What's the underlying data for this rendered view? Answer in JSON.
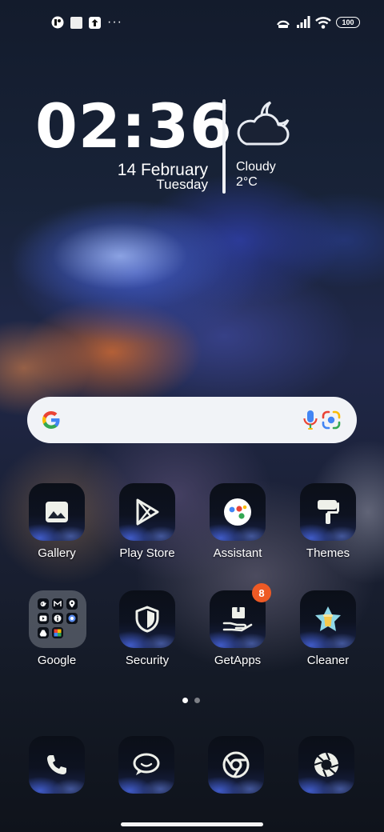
{
  "status_bar": {
    "notification_icons": [
      "notification-app-icon",
      "notification-square-icon",
      "notification-upload-icon"
    ],
    "more": "···",
    "system_icons": [
      "hotspot-icon",
      "signal-icon",
      "wifi-icon"
    ],
    "battery": "100"
  },
  "clock": {
    "time": "02:36",
    "date": "14  February",
    "day": "Tuesday"
  },
  "weather": {
    "condition": "Cloudy",
    "temperature": "2°C",
    "icon": "cloud-moon-icon"
  },
  "search": {
    "icons": [
      "google-g-icon",
      "microphone-icon",
      "google-lens-icon"
    ]
  },
  "apps": [
    {
      "label": "Gallery",
      "icon": "gallery-icon"
    },
    {
      "label": "Play Store",
      "icon": "play-store-icon"
    },
    {
      "label": "Assistant",
      "icon": "assistant-icon"
    },
    {
      "label": "Themes",
      "icon": "themes-icon"
    },
    {
      "label": "Google",
      "icon": "folder-icon"
    },
    {
      "label": "Security",
      "icon": "shield-icon"
    },
    {
      "label": "GetApps",
      "icon": "getapps-icon",
      "badge": "8"
    },
    {
      "label": "Cleaner",
      "icon": "cleaner-icon"
    }
  ],
  "folder_contents": [
    "google-g-icon",
    "gmail-icon",
    "maps-icon",
    "youtube-icon",
    "info-icon",
    "chrome-icon",
    "drive-icon",
    "photos-icon"
  ],
  "page_indicator": {
    "pages": 2,
    "current": 1
  },
  "dock": [
    {
      "icon": "phone-icon"
    },
    {
      "icon": "messages-icon"
    },
    {
      "icon": "chrome-icon"
    },
    {
      "icon": "camera-icon"
    }
  ],
  "colors": {
    "badge": "#ee5a25",
    "search_bar": "#f1f3f7",
    "google_blue": "#4285F4",
    "google_red": "#EA4335",
    "google_yellow": "#FBBC05",
    "google_green": "#34A853"
  }
}
